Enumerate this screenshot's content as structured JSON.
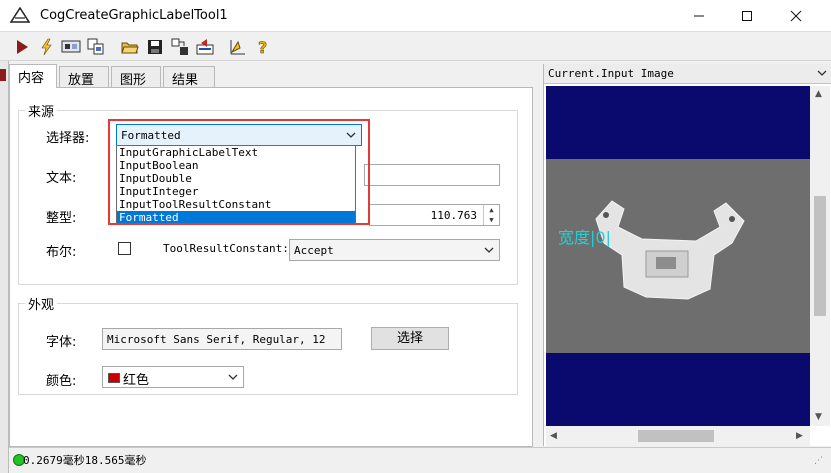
{
  "window": {
    "title": "CogCreateGraphicLabelTool1"
  },
  "tabs": [
    {
      "label": "内容"
    },
    {
      "label": "放置"
    },
    {
      "label": "图形"
    },
    {
      "label": "结果"
    }
  ],
  "source_group": {
    "title": "来源",
    "selector_label": "选择器:",
    "selector_value": "Formatted",
    "selector_options": [
      "InputGraphicLabelText",
      "InputBoolean",
      "InputDouble",
      "InputInteger",
      "InputToolResultConstant",
      "Formatted"
    ],
    "text_label": "文本:",
    "integer_label": "整型:",
    "double_value": "110.763",
    "bool_label": "布尔:",
    "tool_result_label": "ToolResultConstant:",
    "tool_result_value": "Accept"
  },
  "appearance_group": {
    "title": "外观",
    "font_label": "字体:",
    "font_value": "Microsoft Sans Serif, Regular, 12",
    "choose_button": "选择",
    "color_label": "颜色:",
    "color_value": "红色",
    "color_hex": "#cc0000"
  },
  "image_panel": {
    "selector_value": "Current.Input Image",
    "overlay_text": "宽度|0|"
  },
  "status": {
    "text": "0.2679毫秒18.565毫秒"
  },
  "toolbar_icons": [
    "run-icon",
    "lightning-icon",
    "display-icon",
    "copy-icon",
    "open-folder-icon",
    "save-icon",
    "import-icon",
    "export-icon",
    "calibrate-icon",
    "help-icon"
  ]
}
